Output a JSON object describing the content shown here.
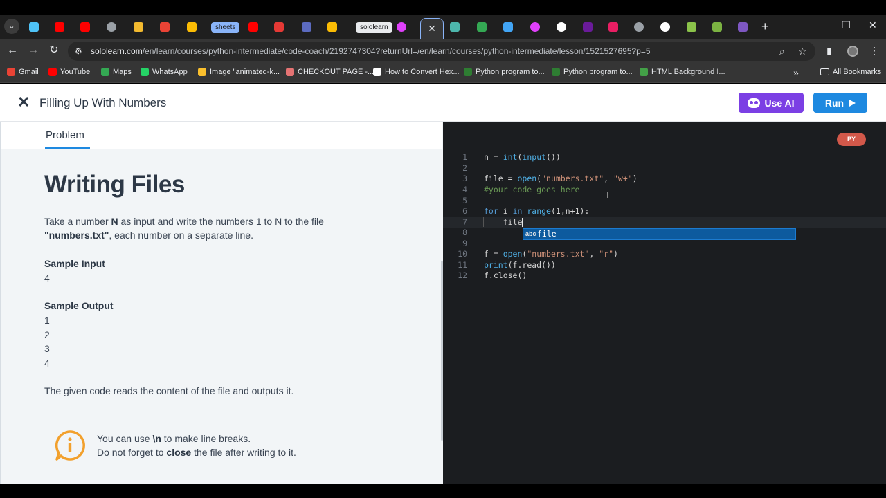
{
  "browser": {
    "tabs": [
      {
        "name": "tab-search-menu",
        "icon": "chevron-down-icon"
      },
      {
        "name": "tab-m",
        "icon": "m-icon",
        "color": "#4fc3f7"
      },
      {
        "name": "tab-youtube-1",
        "icon": "youtube-icon",
        "color": "#ff0000"
      },
      {
        "name": "tab-youtube-2",
        "icon": "youtube-icon",
        "color": "#ff0000"
      },
      {
        "name": "tab-globe",
        "icon": "globe-icon",
        "color": "#9aa0a6"
      },
      {
        "name": "tab-binance",
        "icon": "binance-icon",
        "color": "#f3ba2f"
      },
      {
        "name": "tab-gmail",
        "icon": "gmail-icon",
        "color": "#ea4335"
      },
      {
        "name": "tab-maps",
        "icon": "maps-icon",
        "color": "#fbbc04"
      },
      {
        "name": "tab-sheets",
        "label": "sheets"
      },
      {
        "name": "tab-youtube-3",
        "icon": "youtube-icon",
        "color": "#ff0000"
      },
      {
        "name": "tab-red",
        "icon": "page-icon",
        "color": "#e53935"
      },
      {
        "name": "tab-chatgpt",
        "icon": "app-icon",
        "color": "#5c6bc0"
      },
      {
        "name": "tab-docs",
        "icon": "docs-icon",
        "color": "#fbbc04"
      },
      {
        "name": "tab-sololearn",
        "label": "sololearn"
      },
      {
        "name": "tab-swirl-1",
        "icon": "swirl-icon",
        "color": "#e040fb"
      },
      {
        "name": "tab-active-close",
        "label": "✕"
      },
      {
        "name": "tab-teal",
        "icon": "app-icon",
        "color": "#4db6ac"
      },
      {
        "name": "tab-drive",
        "icon": "drive-icon",
        "color": "#34a853"
      },
      {
        "name": "tab-moon",
        "icon": "moon-icon",
        "color": "#42a5f5"
      },
      {
        "name": "tab-swirl-2",
        "icon": "swirl-icon",
        "color": "#e040fb"
      },
      {
        "name": "tab-google",
        "icon": "google-icon",
        "color": "#ffffff"
      },
      {
        "name": "tab-upwork",
        "icon": "upwork-icon",
        "color": "#6a1b9a"
      },
      {
        "name": "tab-instagram",
        "icon": "instagram-icon",
        "color": "#e91e63"
      },
      {
        "name": "tab-globe-2",
        "icon": "globe-icon",
        "color": "#9aa0a6"
      },
      {
        "name": "tab-chrome",
        "icon": "chrome-icon",
        "color": "#ffffff"
      },
      {
        "name": "tab-tree",
        "icon": "tree-icon",
        "color": "#8bc34a"
      },
      {
        "name": "tab-green",
        "icon": "app-icon",
        "color": "#7cb342"
      },
      {
        "name": "tab-cloud",
        "icon": "cloud-icon",
        "color": "#7e57c2"
      }
    ],
    "new_tab": "+",
    "window_controls": {
      "minimize": "—",
      "maximize": "❐",
      "close": "✕"
    },
    "url_host": "sololearn.com",
    "url_path": "/en/learn/courses/python-intermediate/code-coach/2192747304?returnUrl=/en/learn/courses/python-intermediate/lesson/1521527695?p=5",
    "bookmarks": [
      {
        "label": "Gmail",
        "color": "#ea4335"
      },
      {
        "label": "YouTube",
        "color": "#ff0000"
      },
      {
        "label": "Maps",
        "color": "#34a853"
      },
      {
        "label": "WhatsApp",
        "color": "#25d366"
      },
      {
        "label": "Image \"animated-k...",
        "color": "#fbc02d"
      },
      {
        "label": "CHECKOUT PAGE -...",
        "color": "#e57373"
      },
      {
        "label": "How to Convert Hex...",
        "color": "#ffffff"
      },
      {
        "label": "Python program to...",
        "color": "#2e7d32"
      },
      {
        "label": "Python program to...",
        "color": "#2e7d32"
      },
      {
        "label": "HTML Background I...",
        "color": "#43a047"
      }
    ],
    "bookmarks_more": "»",
    "all_bookmarks": "All Bookmarks"
  },
  "header": {
    "close": "✕",
    "title": "Filling Up With Numbers",
    "use_ai": "Use AI",
    "run": "Run"
  },
  "problem": {
    "tab": "Problem",
    "heading": "Writing Files",
    "desc_line1_a": "Take a number ",
    "desc_line1_b": "N",
    "desc_line1_c": " as input and write the numbers 1 to N to the file",
    "desc_line2_a": "\"numbers.txt\"",
    "desc_line2_b": ", each number on a separate line.",
    "sample_input_label": "Sample Input",
    "sample_input": "4",
    "sample_output_label": "Sample Output",
    "sample_output": [
      "1",
      "2",
      "3",
      "4"
    ],
    "footer": "The given code reads the content of the file and outputs it.",
    "hint_line1_a": "You can use ",
    "hint_line1_b": "\\n",
    "hint_line1_c": " to make line breaks.",
    "hint_line2_a": "Do not forget to ",
    "hint_line2_b": "close",
    "hint_line2_c": " the file after writing to it."
  },
  "editor": {
    "language": "PY",
    "line_numbers": [
      "1",
      "2",
      "3",
      "4",
      "5",
      "6",
      "7",
      "8",
      "9",
      "10",
      "11",
      "12"
    ],
    "autocomplete_kind": "abc",
    "autocomplete_word": "file"
  }
}
